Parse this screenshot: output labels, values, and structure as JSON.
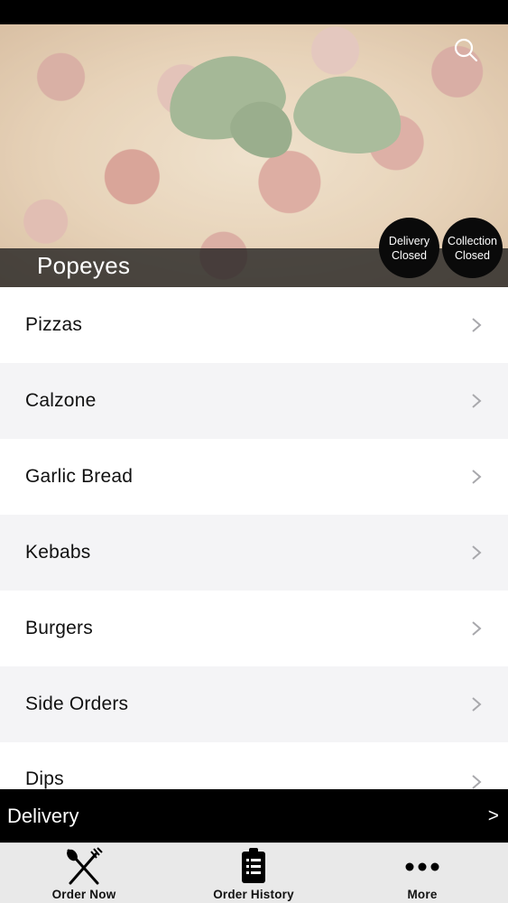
{
  "restaurant": {
    "name": "Popeyes",
    "delivery_status": {
      "line1": "Delivery",
      "line2": "Closed"
    },
    "collection_status": {
      "line1": "Collection",
      "line2": "Closed"
    }
  },
  "icons": {
    "search": "search-icon",
    "chevron": "chevron-right-icon",
    "order_now": "fork-knife-icon",
    "order_history": "clipboard-list-icon",
    "more": "ellipsis-icon"
  },
  "menu": {
    "categories": [
      {
        "label": "Pizzas"
      },
      {
        "label": "Calzone"
      },
      {
        "label": "Garlic Bread"
      },
      {
        "label": "Kebabs"
      },
      {
        "label": "Burgers"
      },
      {
        "label": "Side Orders"
      },
      {
        "label": "Dips"
      }
    ]
  },
  "delivery_bar": {
    "label": "Delivery",
    "arrow": ">"
  },
  "tabs": [
    {
      "label": "Order Now"
    },
    {
      "label": "Order History"
    },
    {
      "label": "More"
    }
  ],
  "colors": {
    "bar_background": "#000000",
    "row_alt": "#f4f4f6",
    "tab_background": "#e9e9e9"
  }
}
